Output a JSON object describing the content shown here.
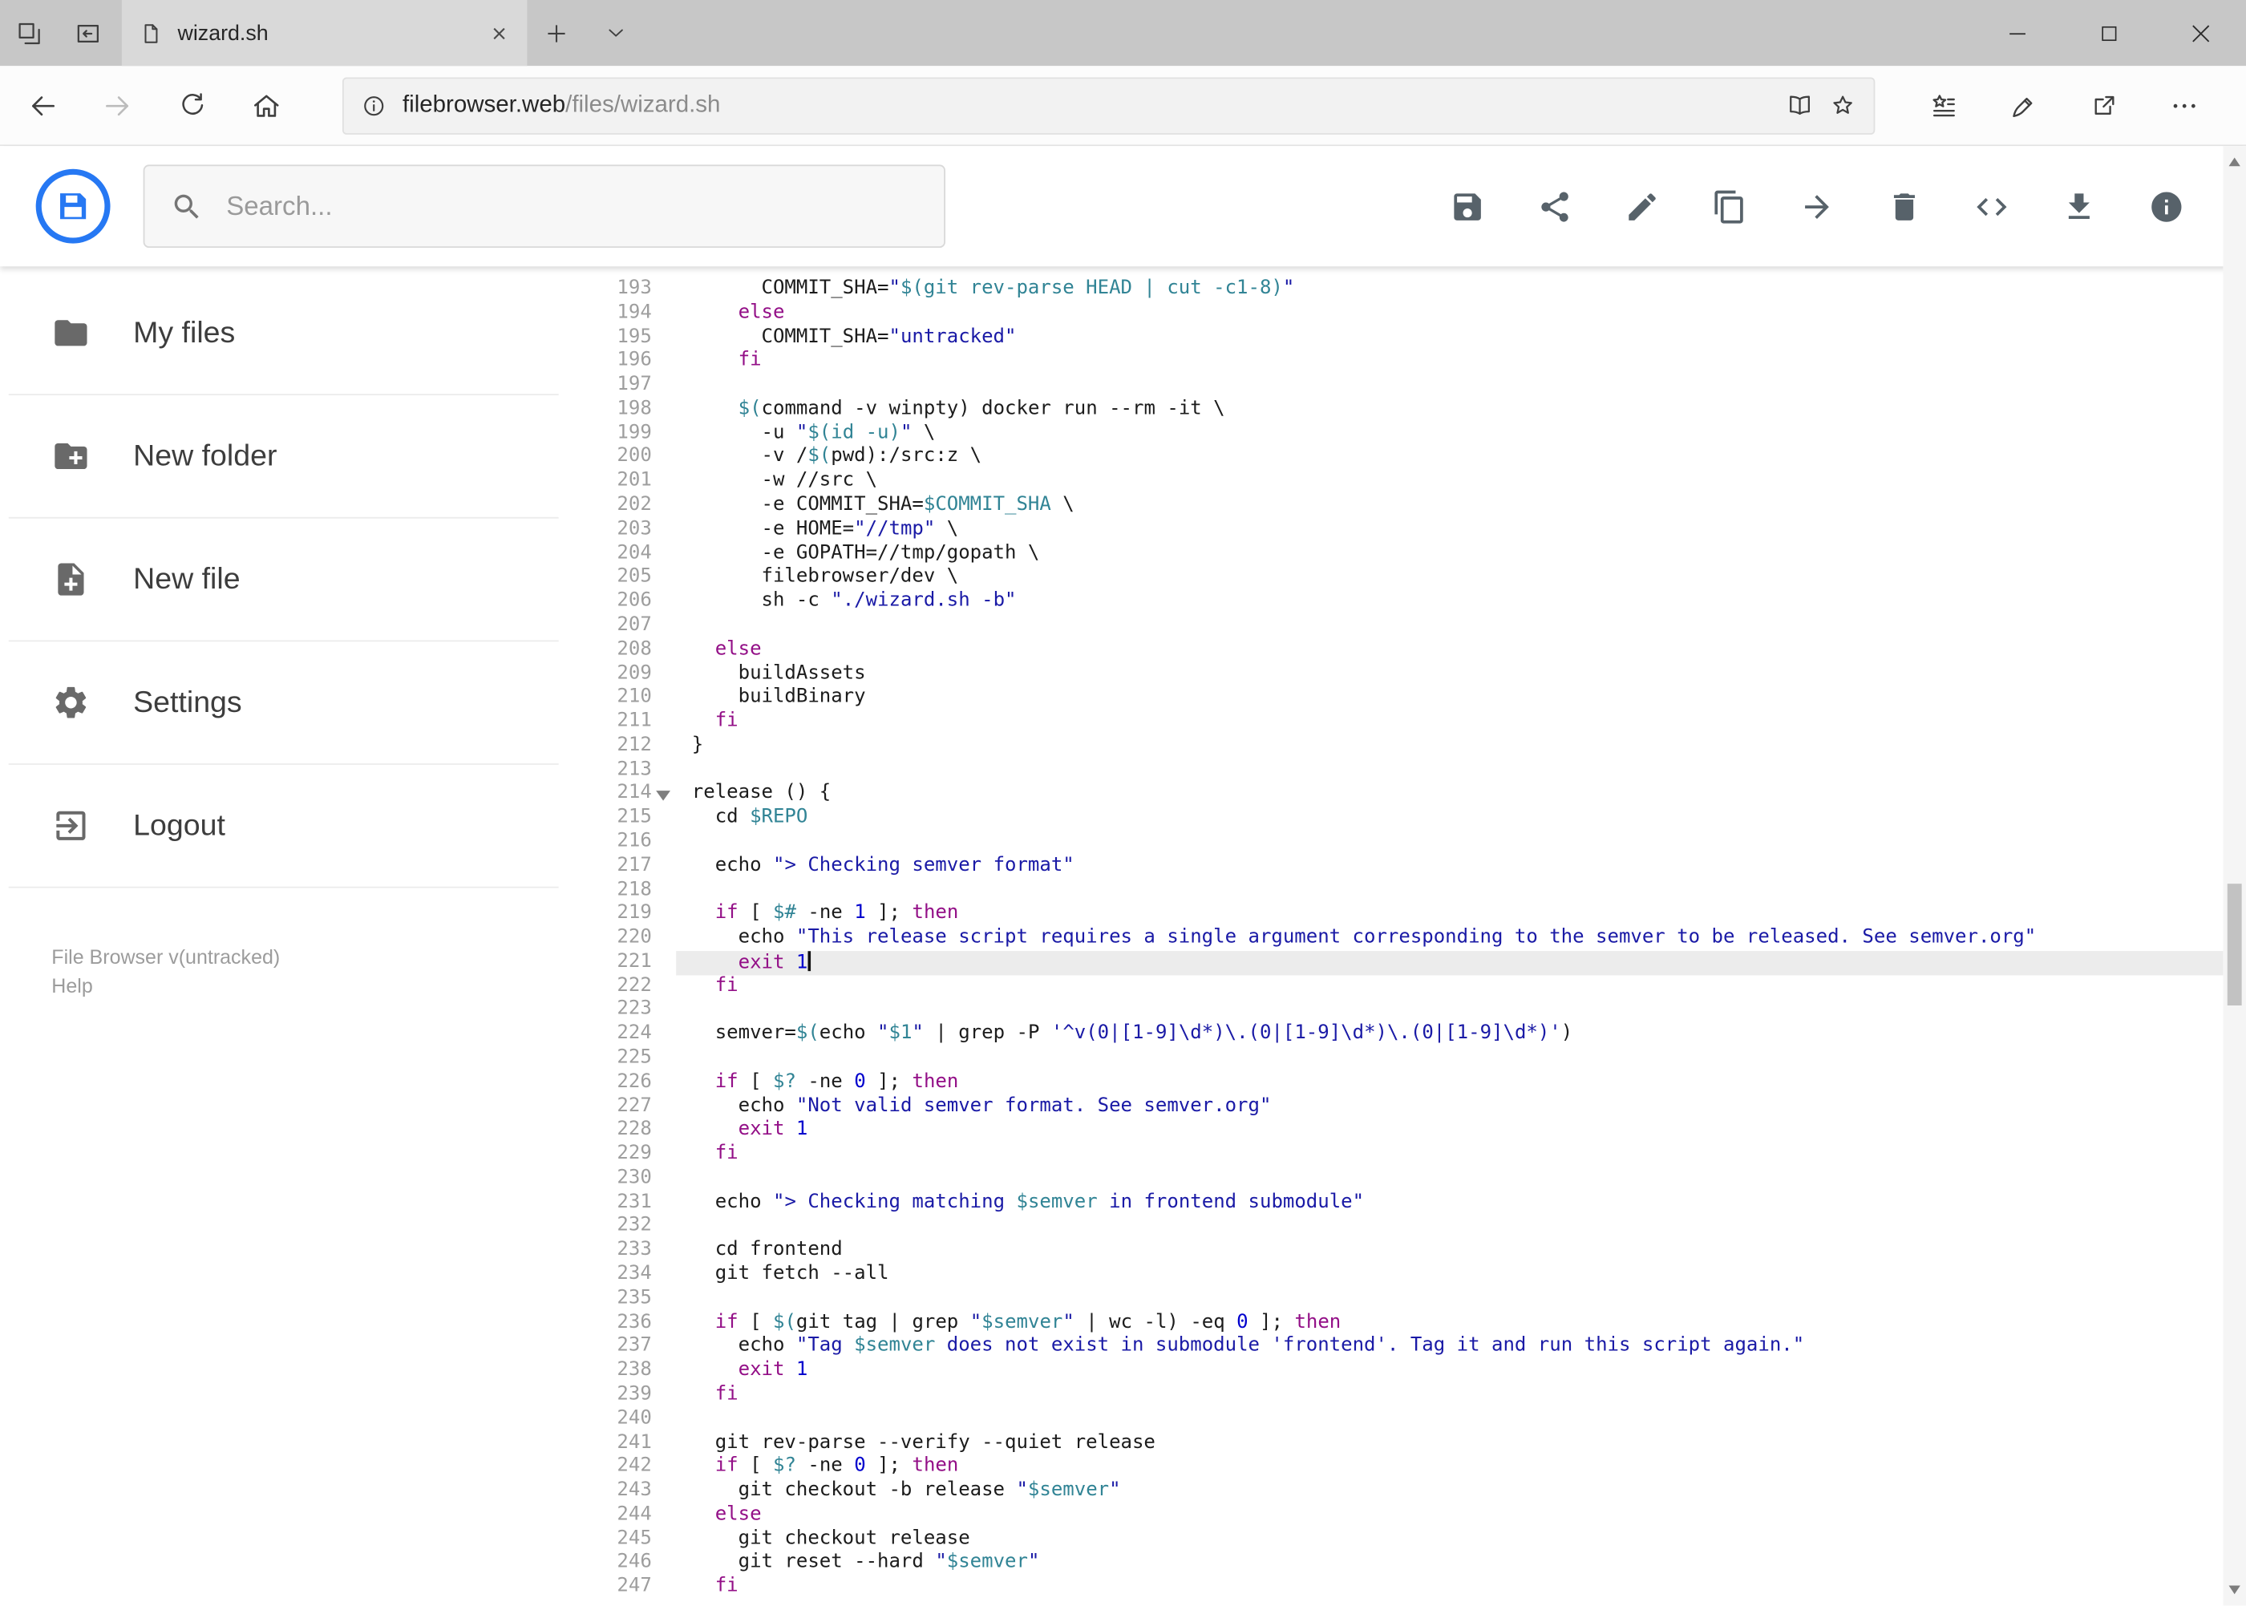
{
  "browser": {
    "tab_title": "wizard.sh",
    "url_host": "filebrowser.web",
    "url_path": "/files/wizard.sh"
  },
  "app": {
    "search_placeholder": "Search...",
    "toolbar": [
      "save",
      "share",
      "rename",
      "copy",
      "move",
      "delete",
      "code",
      "download",
      "info"
    ]
  },
  "sidebar": {
    "items": [
      {
        "label": "My files",
        "icon": "folder"
      },
      {
        "label": "New folder",
        "icon": "folder-plus"
      },
      {
        "label": "New file",
        "icon": "file-plus"
      },
      {
        "label": "Settings",
        "icon": "settings"
      },
      {
        "label": "Logout",
        "icon": "logout"
      }
    ],
    "footer_version": "File Browser v(untracked)",
    "footer_help": "Help"
  },
  "editor": {
    "active_line": 221,
    "fold_line": 214,
    "lines": [
      {
        "n": 193,
        "t": "      COMMIT_SHA=\"$(git rev-parse HEAD | cut -c1-8)\""
      },
      {
        "n": 194,
        "t": "    else"
      },
      {
        "n": 195,
        "t": "      COMMIT_SHA=\"untracked\""
      },
      {
        "n": 196,
        "t": "    fi"
      },
      {
        "n": 197,
        "t": ""
      },
      {
        "n": 198,
        "t": "    $(command -v winpty) docker run --rm -it \\"
      },
      {
        "n": 199,
        "t": "      -u \"$(id -u)\" \\"
      },
      {
        "n": 200,
        "t": "      -v /$(pwd):/src:z \\"
      },
      {
        "n": 201,
        "t": "      -w //src \\"
      },
      {
        "n": 202,
        "t": "      -e COMMIT_SHA=$COMMIT_SHA \\"
      },
      {
        "n": 203,
        "t": "      -e HOME=\"//tmp\" \\"
      },
      {
        "n": 204,
        "t": "      -e GOPATH=//tmp/gopath \\"
      },
      {
        "n": 205,
        "t": "      filebrowser/dev \\"
      },
      {
        "n": 206,
        "t": "      sh -c \"./wizard.sh -b\""
      },
      {
        "n": 207,
        "t": ""
      },
      {
        "n": 208,
        "t": "  else"
      },
      {
        "n": 209,
        "t": "    buildAssets"
      },
      {
        "n": 210,
        "t": "    buildBinary"
      },
      {
        "n": 211,
        "t": "  fi"
      },
      {
        "n": 212,
        "t": "}"
      },
      {
        "n": 213,
        "t": ""
      },
      {
        "n": 214,
        "t": "release () {"
      },
      {
        "n": 215,
        "t": "  cd $REPO"
      },
      {
        "n": 216,
        "t": ""
      },
      {
        "n": 217,
        "t": "  echo \"> Checking semver format\""
      },
      {
        "n": 218,
        "t": ""
      },
      {
        "n": 219,
        "t": "  if [ $# -ne 1 ]; then"
      },
      {
        "n": 220,
        "t": "    echo \"This release script requires a single argument corresponding to the semver to be released. See semver.org\""
      },
      {
        "n": 221,
        "t": "    exit 1"
      },
      {
        "n": 222,
        "t": "  fi"
      },
      {
        "n": 223,
        "t": ""
      },
      {
        "n": 224,
        "t": "  semver=$(echo \"$1\" | grep -P '^v(0|[1-9]\\d*)\\.(0|[1-9]\\d*)\\.(0|[1-9]\\d*)')"
      },
      {
        "n": 225,
        "t": ""
      },
      {
        "n": 226,
        "t": "  if [ $? -ne 0 ]; then"
      },
      {
        "n": 227,
        "t": "    echo \"Not valid semver format. See semver.org\""
      },
      {
        "n": 228,
        "t": "    exit 1"
      },
      {
        "n": 229,
        "t": "  fi"
      },
      {
        "n": 230,
        "t": ""
      },
      {
        "n": 231,
        "t": "  echo \"> Checking matching $semver in frontend submodule\""
      },
      {
        "n": 232,
        "t": ""
      },
      {
        "n": 233,
        "t": "  cd frontend"
      },
      {
        "n": 234,
        "t": "  git fetch --all"
      },
      {
        "n": 235,
        "t": ""
      },
      {
        "n": 236,
        "t": "  if [ $(git tag | grep \"$semver\" | wc -l) -eq 0 ]; then"
      },
      {
        "n": 237,
        "t": "    echo \"Tag $semver does not exist in submodule 'frontend'. Tag it and run this script again.\""
      },
      {
        "n": 238,
        "t": "    exit 1"
      },
      {
        "n": 239,
        "t": "  fi"
      },
      {
        "n": 240,
        "t": ""
      },
      {
        "n": 241,
        "t": "  git rev-parse --verify --quiet release"
      },
      {
        "n": 242,
        "t": "  if [ $? -ne 0 ]; then"
      },
      {
        "n": 243,
        "t": "    git checkout -b release \"$semver\""
      },
      {
        "n": 244,
        "t": "  else"
      },
      {
        "n": 245,
        "t": "    git checkout release"
      },
      {
        "n": 246,
        "t": "    git reset --hard \"$semver\""
      },
      {
        "n": 247,
        "t": "  fi"
      }
    ]
  },
  "colors": {
    "accent_blue": "#2678f3",
    "keyword": "#930f87",
    "string": "#1a1aa6",
    "variable": "#318495",
    "number": "#0000cd",
    "active_line_bg": "#ececec"
  }
}
